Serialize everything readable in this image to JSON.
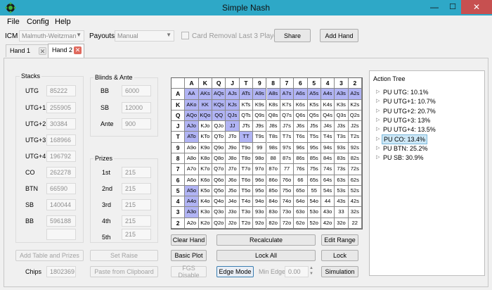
{
  "window": {
    "title": "Simple Nash",
    "min": "—",
    "max": "☐",
    "close": "✕"
  },
  "menu": [
    "File",
    "Config",
    "Help"
  ],
  "options": {
    "icm_label": "ICM",
    "icm_value": "Malmuth-Weitzman",
    "payouts_label": "Payouts",
    "payouts_value": "Manual",
    "card_removal_label": "Card Removal Last 3 Players",
    "share_label": "Share",
    "add_hand_label": "Add Hand"
  },
  "tabs": [
    {
      "label": "Hand 1",
      "close": "✕"
    },
    {
      "label": "Hand 2",
      "close": "✕"
    }
  ],
  "stacks": {
    "title": "Stacks",
    "rows": [
      {
        "label": "UTG",
        "value": "85222"
      },
      {
        "label": "UTG+1",
        "value": "255905"
      },
      {
        "label": "UTG+2",
        "value": "30384"
      },
      {
        "label": "UTG+3",
        "value": "168966"
      },
      {
        "label": "UTG+4",
        "value": "196792"
      },
      {
        "label": "CO",
        "value": "262278"
      },
      {
        "label": "BTN",
        "value": "66590"
      },
      {
        "label": "SB",
        "value": "140044"
      },
      {
        "label": "BB",
        "value": "596188"
      },
      {
        "label": "",
        "value": ""
      }
    ]
  },
  "blinds": {
    "title": "Blinds & Ante",
    "rows": [
      {
        "label": "BB",
        "value": "6000"
      },
      {
        "label": "SB",
        "value": "12000"
      },
      {
        "label": "Ante",
        "value": "900"
      }
    ]
  },
  "prizes": {
    "title": "Prizes",
    "rows": [
      {
        "label": "1st",
        "value": "215"
      },
      {
        "label": "2nd",
        "value": "215"
      },
      {
        "label": "3rd",
        "value": "215"
      },
      {
        "label": "4th",
        "value": "215"
      },
      {
        "label": "5th",
        "value": "215"
      }
    ]
  },
  "left_buttons": {
    "add_table": "Add Table and Prizes",
    "set_raise": "Set Raise",
    "chips_label": "Chips",
    "chips_value": "1802369",
    "paste": "Paste from Clipboard"
  },
  "grid": {
    "ranks": [
      "A",
      "K",
      "Q",
      "J",
      "T",
      "9",
      "8",
      "7",
      "6",
      "5",
      "4",
      "3",
      "2"
    ],
    "highlight_color": "#b1b4f4",
    "selected": [
      "AA",
      "AKs",
      "AQs",
      "AJs",
      "ATs",
      "A9s",
      "A8s",
      "A7s",
      "A6s",
      "A5s",
      "A4s",
      "A3s",
      "A2s",
      "AKo",
      "KK",
      "KQs",
      "KJs",
      "AQo",
      "KQo",
      "QQ",
      "QJs",
      "AJo",
      "JJ",
      "ATo",
      "TT",
      "A5o",
      "A4o",
      "A3o"
    ]
  },
  "grid_buttons": {
    "clear_hand": "Clear Hand",
    "recalculate": "Recalculate",
    "edit_range": "Edit Range",
    "basic_plot": "Basic Plot",
    "lock_all": "Lock All",
    "lock": "Lock",
    "fgs_disable": "FGS Disable",
    "edge_mode": "Edge Mode",
    "min_edge_label": "Min Edge",
    "min_edge_value": "0.00",
    "simulation": "Simulation"
  },
  "action_tree": {
    "title": "Action Tree",
    "items": [
      "PU UTG: 10.1%",
      "PU UTG+1: 10.7%",
      "PU UTG+2: 20.7%",
      "PU UTG+3: 13%",
      "PU UTG+4: 13.5%",
      "PU CO: 13.4%",
      "PU BTN: 25.2%",
      "PU SB: 30.9%"
    ],
    "selected_index": 5
  }
}
